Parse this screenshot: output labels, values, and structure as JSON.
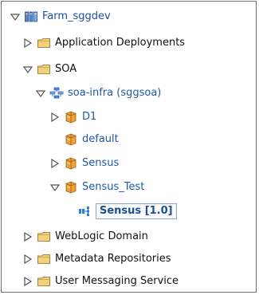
{
  "tree": {
    "root": {
      "label": "Farm_sggdev",
      "icon": "farm-icon",
      "expanded": true
    },
    "items": [
      {
        "label": "Application Deployments",
        "icon": "folder-icon",
        "expanded": false
      },
      {
        "label": "SOA",
        "icon": "folder-icon",
        "expanded": true
      },
      {
        "label": "soa-infra (sggsoa)",
        "icon": "soa-infra-icon",
        "expanded": true
      },
      {
        "label": "D1",
        "icon": "partition-icon",
        "expanded": false
      },
      {
        "label": "default",
        "icon": "partition-icon",
        "expanded": null
      },
      {
        "label": "Sensus",
        "icon": "partition-icon",
        "expanded": false
      },
      {
        "label": "Sensus_Test",
        "icon": "partition-icon",
        "expanded": true
      },
      {
        "label": "Sensus [1.0]",
        "icon": "composite-icon",
        "expanded": null,
        "selected": true
      },
      {
        "label": "WebLogic Domain",
        "icon": "folder-icon",
        "expanded": false
      },
      {
        "label": "Metadata Repositories",
        "icon": "folder-icon",
        "expanded": false
      },
      {
        "label": "User Messaging Service",
        "icon": "folder-icon",
        "expanded": false
      }
    ]
  },
  "colors": {
    "tree_text": "#1f5aa6",
    "black_text": "#111111",
    "folder": "#f1d27a",
    "folder_stroke": "#8a6b1f",
    "partition": "#f0a13a",
    "composite": "#2c7de0",
    "toggle": "#555555"
  }
}
